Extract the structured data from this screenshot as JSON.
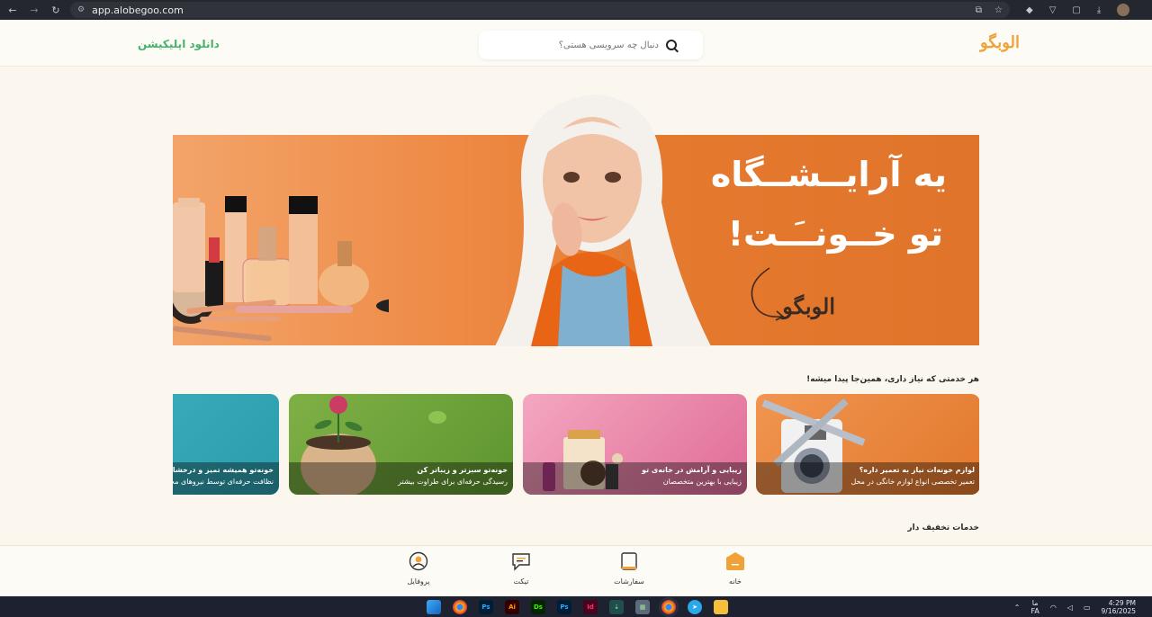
{
  "browser": {
    "url": "app.alobegoo.com",
    "back_icon": "arrow-left-icon",
    "forward_icon": "arrow-right-icon",
    "reload_icon": "reload-icon"
  },
  "header": {
    "logo_text": "الوبگو",
    "search_placeholder": "دنبال چه سرویسی هستی؟",
    "download_app": "دانلود اپلیکیشن"
  },
  "banner": {
    "headline_line1": "یه آرایــشــگاه",
    "headline_line2": "تو خــونــَـت!",
    "brand": "الوبگو",
    "accent_color": "#e57a2f"
  },
  "services": {
    "title": "هر خدمتی که نیاز داری، همین‌جا پیدا میشه!",
    "cards": [
      {
        "title": "لوازم خونه‌ات نیاز به تعمیر داره؟",
        "subtitle": "تعمیر تخصصی انواع لوازم خانگی در محل"
      },
      {
        "title": "زیبایی و آرامش در خانه‌ی تو",
        "subtitle": "زیبایی با بهترین متخصصان"
      },
      {
        "title": "خونه‌تو سبزتر و زیباتر کن",
        "subtitle": "رسیدگی حرفه‌ای برای طراوت بیشتر"
      },
      {
        "title": "خونه‌تو همیشه تمیز و درخشان کن",
        "subtitle": "نظافت حرفه‌ای توسط نیروهای مجرب"
      }
    ]
  },
  "discounts": {
    "title": "خدمات تخفیف دار"
  },
  "bottom_nav": {
    "items": [
      {
        "label": "خانه",
        "icon": "home-icon",
        "active": true
      },
      {
        "label": "سفارشات",
        "icon": "orders-icon",
        "active": false
      },
      {
        "label": "تیکت",
        "icon": "ticket-icon",
        "active": false
      },
      {
        "label": "پروفایل",
        "icon": "profile-icon",
        "active": false
      }
    ]
  },
  "taskbar": {
    "lang_top": "ما",
    "lang_bottom": "FA",
    "time": "4:29 PM",
    "date": "9/16/2025"
  }
}
